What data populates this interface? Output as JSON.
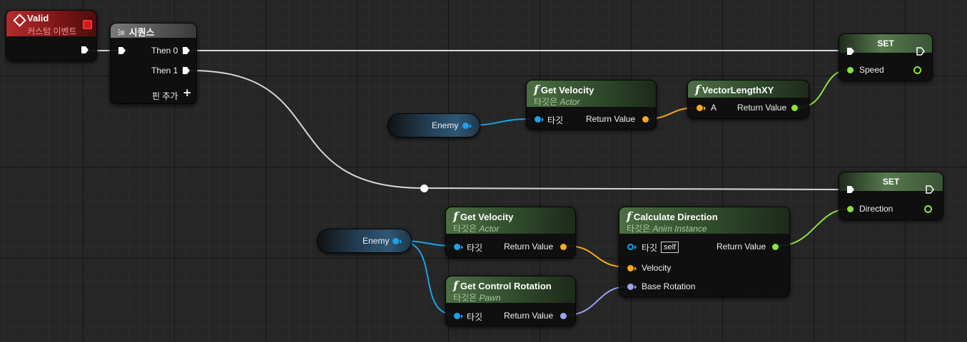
{
  "colors": {
    "exec": "#ffffff",
    "object": "#1ba3ea",
    "vector": "#f6aa1c",
    "float": "#8be33a",
    "rotator": "#9aa4ef"
  },
  "event": {
    "title": "Valid",
    "subtitle": "커스텀 이벤트",
    "icon": "diamond-icon"
  },
  "sequence": {
    "title": "시퀀스",
    "icon": "sequence-icon",
    "then0": "Then 0",
    "then1": "Then 1",
    "add_pin": "핀 추가",
    "add_icon": "plus-icon"
  },
  "set_speed": {
    "title": "SET",
    "pin": "Speed"
  },
  "set_direction": {
    "title": "SET",
    "pin": "Direction"
  },
  "vel1": {
    "symbol": "f",
    "title": "Get Velocity",
    "sub_prefix": "타깃은",
    "sub_type": "Actor",
    "target": "타깃",
    "ret": "Return Value"
  },
  "vlxy": {
    "symbol": "f",
    "title": "VectorLengthXY",
    "a": "A",
    "ret": "Return Value"
  },
  "enemy1": {
    "label": "Enemy"
  },
  "enemy2": {
    "label": "Enemy"
  },
  "vel2": {
    "symbol": "f",
    "title": "Get Velocity",
    "sub_prefix": "타깃은",
    "sub_type": "Actor",
    "target": "타깃",
    "ret": "Return Value"
  },
  "calc": {
    "symbol": "f",
    "title": "Calculate Direction",
    "sub_prefix": "타깃은",
    "sub_type": "Anim Instance",
    "target": "타깃",
    "self": "self",
    "ret": "Return Value",
    "velocity": "Velocity",
    "base_rotation": "Base Rotation"
  },
  "rot": {
    "symbol": "f",
    "title": "Get Control Rotation",
    "sub_prefix": "타깃은",
    "sub_type": "Pawn",
    "target": "타깃",
    "ret": "Return Value"
  }
}
